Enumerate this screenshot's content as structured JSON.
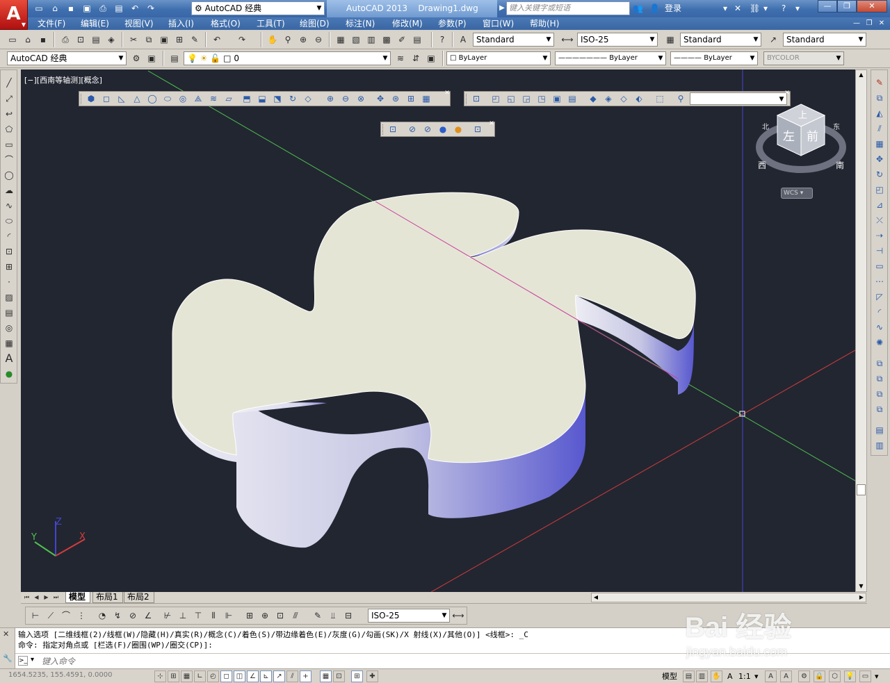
{
  "window": {
    "app_name": "AutoCAD 2013",
    "doc_name": "Drawing1.dwg",
    "workspace": "AutoCAD 经典",
    "search_placeholder": "键入关键字或短语",
    "sign_in": "登录"
  },
  "menubar": [
    "文件(F)",
    "编辑(E)",
    "视图(V)",
    "插入(I)",
    "格式(O)",
    "工具(T)",
    "绘图(D)",
    "标注(N)",
    "修改(M)",
    "参数(P)",
    "窗口(W)",
    "帮助(H)"
  ],
  "styles": {
    "text_style": "Standard",
    "dim_style": "ISO-25",
    "table_style": "Standard",
    "multileader_style": "Standard"
  },
  "layers_row": {
    "workspace": "AutoCAD 经典",
    "layer_name": "0",
    "color": "ByLayer",
    "linetype": "ByLayer",
    "lineweight": "ByLayer",
    "plot_style": "BYCOLOR"
  },
  "viewport": {
    "label": "[−][西南等轴测][概念]",
    "bg_color": "#222631",
    "viewcube": {
      "top": "上",
      "left": "左",
      "front": "前",
      "north": "北",
      "east": "东",
      "south": "南",
      "west": "西"
    },
    "wcs_label": "WCS",
    "ucs_axes": {
      "x": "X",
      "y": "Y",
      "z": "Z"
    },
    "colors": {
      "top_face": "#e5e5d6",
      "side_light": "#ececf3",
      "side_dark": "#5a5ad2",
      "axis_green": "#4fc04f",
      "axis_red": "#d23c3c",
      "axis_blue": "#4545d0",
      "axis_magenta": "#c83c9a"
    }
  },
  "layout_tabs": [
    "模型",
    "布局1",
    "布局2"
  ],
  "dim_style_combo": "ISO-25",
  "command": {
    "history": [
      "输入选项 [二维线框(2)/线框(W)/隐藏(H)/真实(R)/概念(C)/着色(S)/带边缘着色(E)/灰度(G)/勾画(SK)/X 射线(X)/其他(O)] <线框>: _C",
      "命令: 指定对角点或 [栏选(F)/圈围(WP)/圈交(CP)]:"
    ],
    "input_placeholder": "键入命令"
  },
  "statusbar": {
    "coordinates": "1654.5235, 155.4591, 0.0000",
    "model": "模型",
    "scale": "1:1"
  },
  "watermark": {
    "brand": "Bai 经验",
    "url": "jingyan.baidu.com"
  }
}
